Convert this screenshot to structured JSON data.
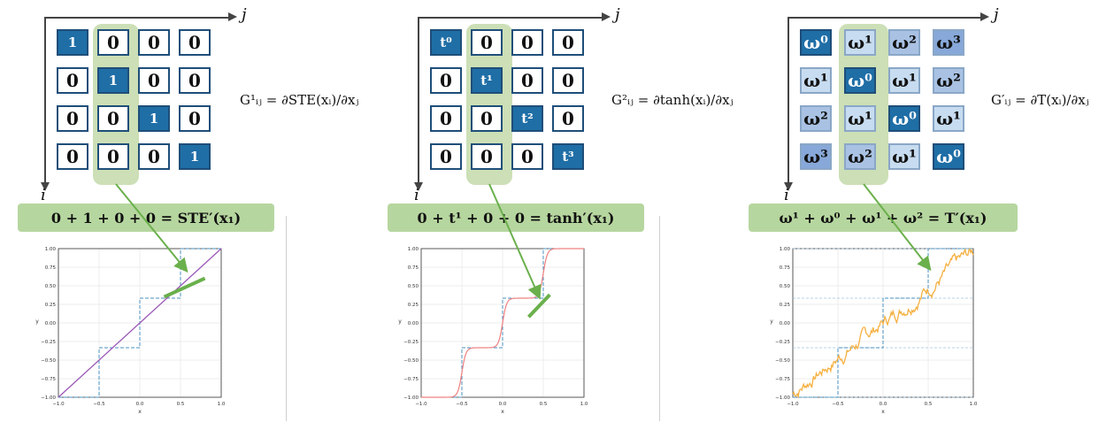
{
  "axes": {
    "j": "j",
    "i": "i"
  },
  "panels": [
    {
      "id": "ste",
      "cells": [
        [
          "1",
          "0",
          "0",
          "0"
        ],
        [
          "0",
          "1",
          "0",
          "0"
        ],
        [
          "0",
          "0",
          "1",
          "0"
        ],
        [
          "0",
          "0",
          "0",
          "1"
        ]
      ],
      "formula": "G¹ᵢⱼ = ∂STE(xᵢ)/∂xⱼ",
      "sum": "0 + 1 + 0 + 0  = STE′(x₁)"
    },
    {
      "id": "tanh",
      "cells": [
        [
          "t⁰",
          "0",
          "0",
          "0"
        ],
        [
          "0",
          "t¹",
          "0",
          "0"
        ],
        [
          "0",
          "0",
          "t²",
          "0"
        ],
        [
          "0",
          "0",
          "0",
          "t³"
        ]
      ],
      "formula": "G²ᵢⱼ = ∂tanh(xᵢ)/∂xⱼ",
      "sum": "0 + t¹ + 0 + 0  = tanh′(x₁)"
    },
    {
      "id": "omega",
      "cells": [
        [
          "ω⁰",
          "ω¹",
          "ω²",
          "ω³"
        ],
        [
          "ω¹",
          "ω⁰",
          "ω¹",
          "ω²"
        ],
        [
          "ω²",
          "ω¹",
          "ω⁰",
          "ω¹"
        ],
        [
          "ω³",
          "ω²",
          "ω¹",
          "ω⁰"
        ]
      ],
      "formula": "G′ᵢⱼ = ∂T(xᵢ)/∂xⱼ",
      "sum": "ω¹ + ω⁰ + ω¹ + ω²  = T′(x₁)"
    }
  ],
  "plot_axes": {
    "xlabel": "x",
    "ylabel": "y",
    "xticks": [
      "−1.0",
      "−0.5",
      "0.0",
      "0.5",
      "1.0"
    ],
    "yticks": [
      "1.00",
      "0.75",
      "0.50",
      "0.25",
      "0.00",
      "−0.25",
      "−0.50",
      "−0.75",
      "−1.00"
    ]
  },
  "colors": {
    "diag_cell": "#1f6ea6",
    "highlight": "#c9ddb2",
    "green_arrow": "#6ab04c",
    "ste_line": "#9b59b6",
    "tanh_line": "#f08080",
    "omega_line": "#f5b041",
    "step_dash": "#4a90c2"
  }
}
